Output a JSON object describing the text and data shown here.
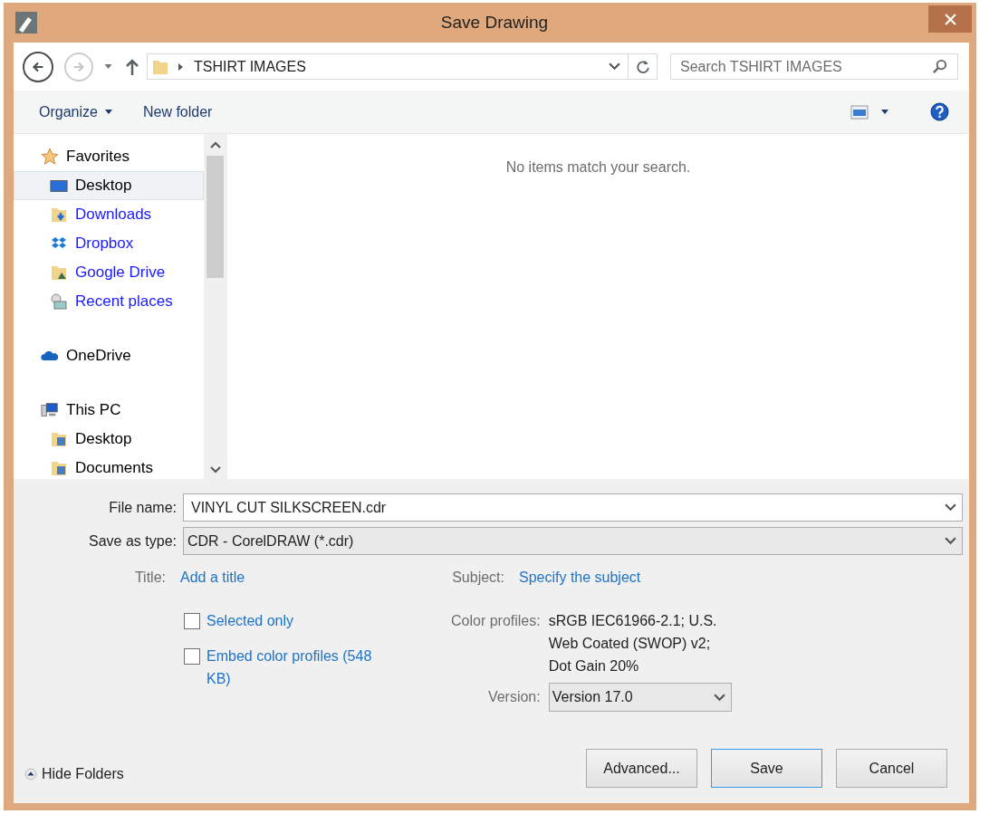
{
  "window": {
    "title": "Save Drawing"
  },
  "address": {
    "path": "TSHIRT IMAGES"
  },
  "search": {
    "placeholder": "Search TSHIRT IMAGES"
  },
  "toolbar": {
    "organize": "Organize",
    "new_folder": "New folder"
  },
  "nav_pane": [
    {
      "label": "Favorites",
      "kind": "star",
      "selected": false,
      "color": "#000000",
      "children": [
        {
          "label": "Desktop",
          "kind": "monitor",
          "selected": true,
          "color": "#000000"
        },
        {
          "label": "Downloads",
          "kind": "download",
          "selected": false,
          "color": "#1a1aff"
        },
        {
          "label": "Dropbox",
          "kind": "dropbox",
          "selected": false,
          "color": "#1a1aff"
        },
        {
          "label": "Google Drive",
          "kind": "drive",
          "selected": false,
          "color": "#1a1aff"
        },
        {
          "label": "Recent places",
          "kind": "recent",
          "selected": false,
          "color": "#1a1aff"
        }
      ]
    },
    {
      "label": "OneDrive",
      "kind": "cloud",
      "selected": false,
      "color": "#000000"
    },
    {
      "label": "This PC",
      "kind": "computer",
      "selected": false,
      "color": "#000000",
      "children": [
        {
          "label": "Desktop",
          "kind": "folder",
          "selected": false,
          "color": "#000000"
        },
        {
          "label": "Documents",
          "kind": "folder",
          "selected": false,
          "color": "#000000"
        }
      ]
    }
  ],
  "content": {
    "empty_message": "No items match your search."
  },
  "form": {
    "file_name_label": "File name:",
    "file_name": "VINYL CUT SILKSCREEN.cdr",
    "type_label": "Save as type:",
    "type": "CDR - CorelDRAW (*.cdr)",
    "title_label": "Title:",
    "title_link": "Add a title",
    "subject_label": "Subject:",
    "subject_link": "Specify the subject"
  },
  "options": [
    {
      "label": "Selected only",
      "checked": false
    },
    {
      "label": "Embed color profiles (548 KB)",
      "checked": false
    }
  ],
  "color_profiles": {
    "label": "Color profiles:",
    "value": "sRGB IEC61966-2.1; U.S. Web Coated (SWOP) v2; Dot Gain 20%"
  },
  "version": {
    "label": "Version:",
    "value": "Version 17.0"
  },
  "hide_folders": "Hide Folders",
  "buttons": [
    {
      "label": "Advanced...",
      "default": false
    },
    {
      "label": "Save",
      "default": true
    },
    {
      "label": "Cancel",
      "default": false
    }
  ]
}
